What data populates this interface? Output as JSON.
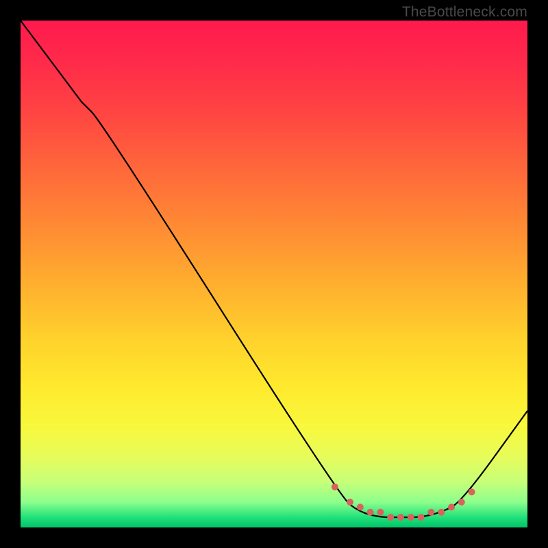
{
  "watermark": "TheBottleneck.com",
  "chart_data": {
    "type": "line",
    "title": "",
    "xlabel": "",
    "ylabel": "",
    "xlim": [
      0,
      100
    ],
    "ylim": [
      0,
      100
    ],
    "grid": false,
    "series": [
      {
        "name": "curve",
        "color": "#000000",
        "x": [
          0,
          12,
          16,
          63,
          67,
          71,
          75,
          79,
          83,
          87,
          100
        ],
        "values": [
          100,
          84,
          80,
          6,
          3,
          2,
          2,
          2,
          3,
          5,
          23
        ]
      }
    ],
    "markers": {
      "name": "highlight-dots",
      "color": "#d9635c",
      "x": [
        62,
        65,
        67,
        69,
        71,
        73,
        75,
        77,
        79,
        81,
        83,
        85,
        87,
        89
      ],
      "values": [
        8,
        5,
        4,
        3,
        3,
        2,
        2,
        2,
        2,
        3,
        3,
        4,
        5,
        7
      ]
    },
    "gradient_stops": [
      {
        "pct": 0,
        "color": "#ff1a4d"
      },
      {
        "pct": 18,
        "color": "#ff4442"
      },
      {
        "pct": 42,
        "color": "#ff8f33"
      },
      {
        "pct": 63,
        "color": "#ffd22c"
      },
      {
        "pct": 80,
        "color": "#f8f83c"
      },
      {
        "pct": 95,
        "color": "#8cff8c"
      },
      {
        "pct": 100,
        "color": "#00c46a"
      }
    ]
  }
}
